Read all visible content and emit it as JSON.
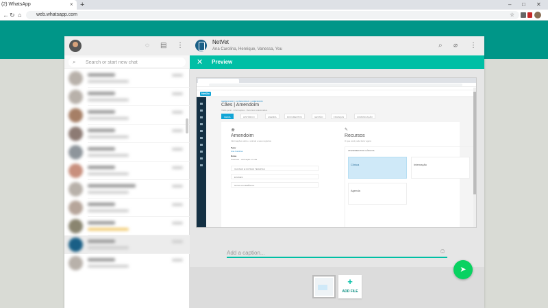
{
  "browser": {
    "tab_title": "(2) WhatsApp",
    "tab_close": "×",
    "new_tab": "+",
    "url": "web.whatsapp.com",
    "win_min": "–",
    "win_max": "□",
    "win_close": "✕",
    "back": "←",
    "forward": "→",
    "reload": "↻",
    "home": "⌂",
    "bookmark_star": "☆"
  },
  "colors": {
    "teal": "#009688",
    "preview_green": "#00bfa5",
    "send_green": "#09d261"
  },
  "sidebar": {
    "search_placeholder": "Search or start new chat",
    "icons": [
      "status-icon",
      "new-chat-icon",
      "menu-icon"
    ]
  },
  "conversation": {
    "name": "NetVet",
    "members": "Ana Carolina, Henrique, Vanessa, You",
    "icons": [
      "search-icon",
      "attach-icon",
      "menu-icon"
    ]
  },
  "preview": {
    "title": "Preview",
    "close_glyph": "✕",
    "caption_placeholder": "Add a caption...",
    "add_file_label": "ADD FILE",
    "add_file_glyph": "+",
    "send_glyph": "➤",
    "emoji_glyph": "☺"
  },
  "shot": {
    "logo": "NetGo",
    "breadcrumb": "GERENCIAR > CATEGORIAS > AMENDOIM",
    "title": "Cães | Amendoim",
    "subtitle": "Visão geral · Informações · Recursos relacionados",
    "tabs": [
      "GERAL",
      "HISTÓRICO",
      "AGENDA",
      "DOCUMENTOS",
      "GESTÃO",
      "FINANÇAS",
      "COMUNICAÇÃO"
    ],
    "category": "Amendoim",
    "category_desc": "Informações sobre o animal e seus registros",
    "tutor_label": "Tutor",
    "tutor_value": "Ana Carolina",
    "notes_label": "Notas",
    "notes_value": "Castrado · vacinação em dia",
    "rows": [
      "VACINAS E OUTRAS TERAPIAS",
      "EXAMES",
      "NOVA OCORRÊNCIA"
    ],
    "resources_title": "Recursos",
    "resources_sub": "O que você pode fazer agora",
    "resources_head": "ATENDIMENTOS CLÍNICOS",
    "tiles": [
      "Clínica",
      "Internação",
      "Agenda"
    ]
  }
}
